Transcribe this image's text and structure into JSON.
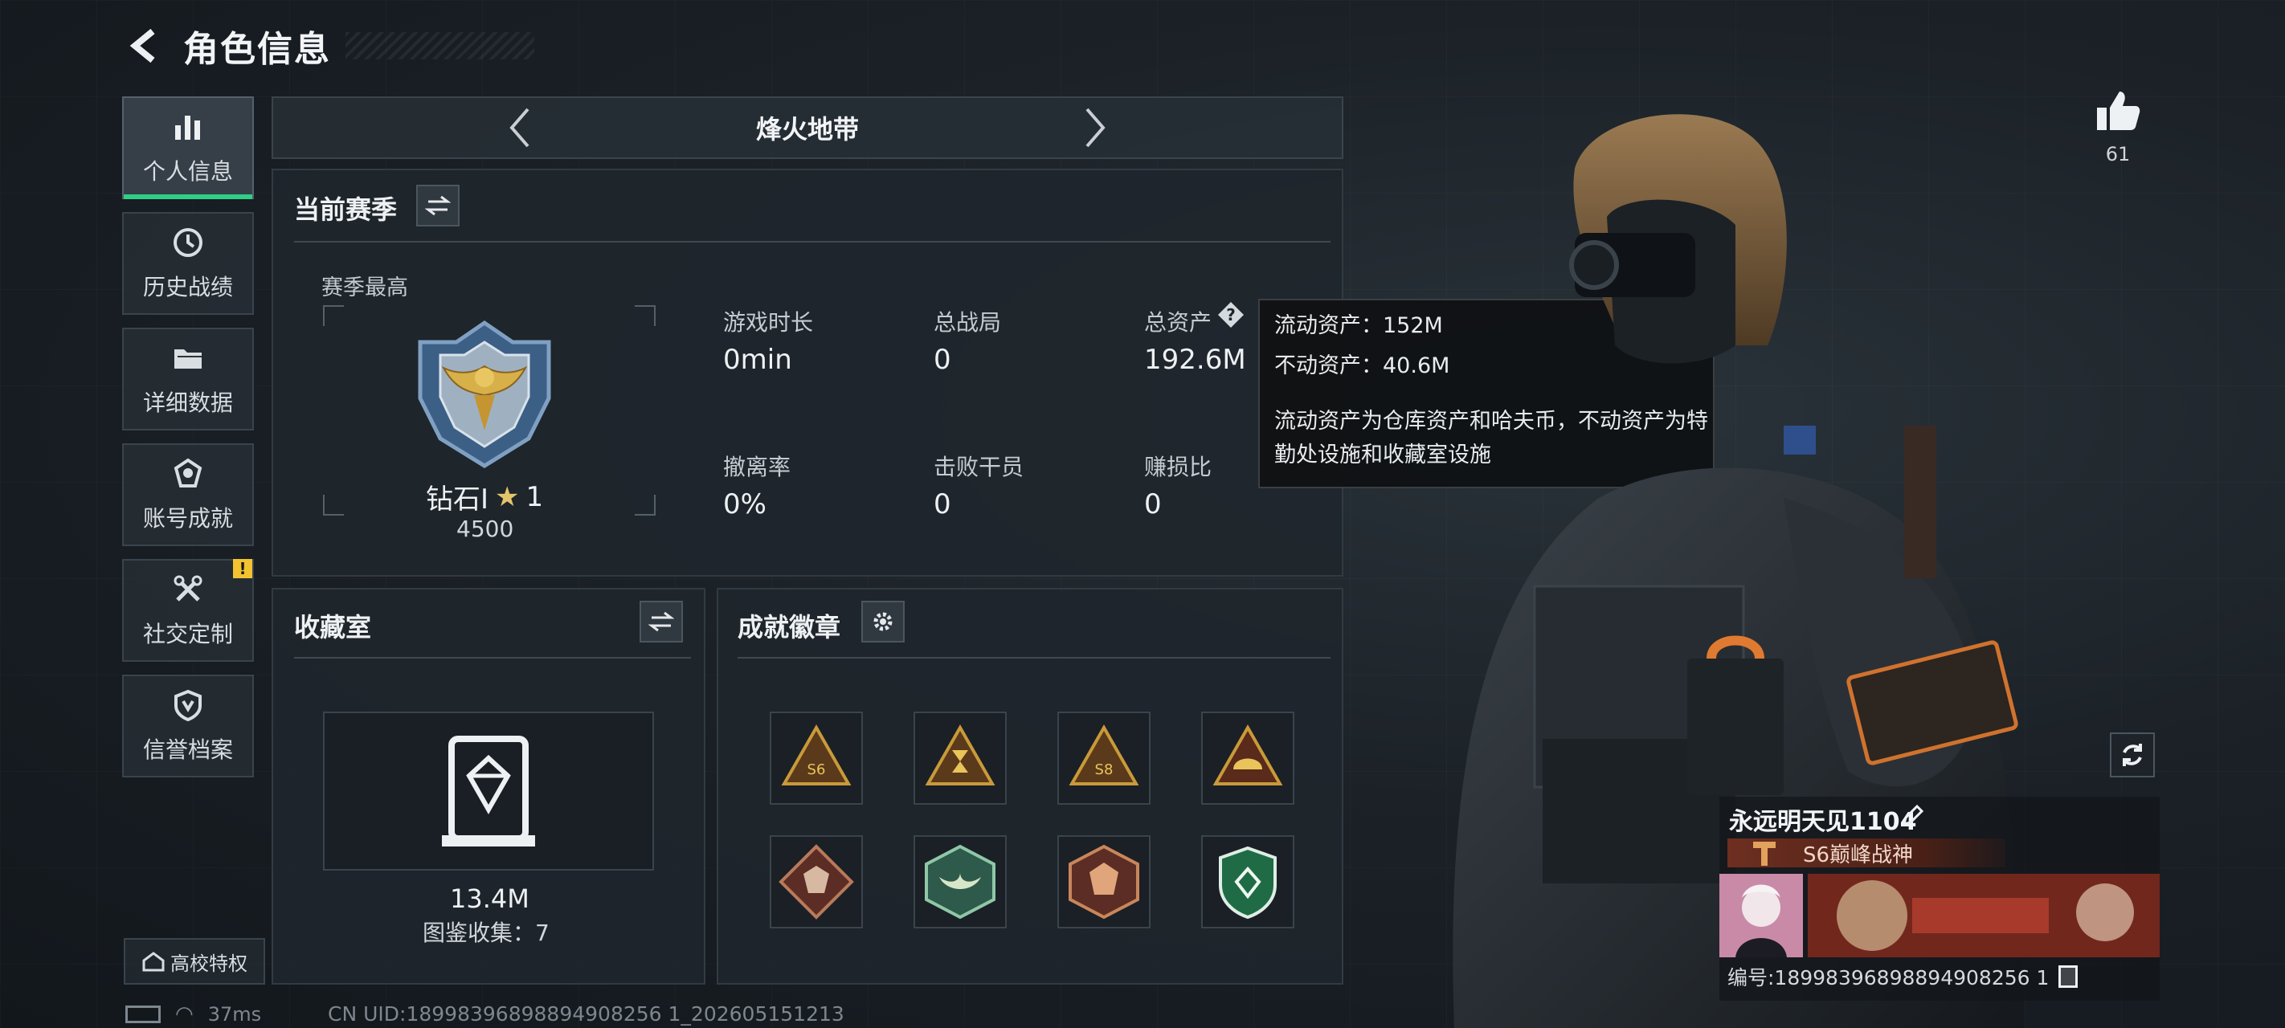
{
  "header": {
    "title": "角色信息"
  },
  "sidebar": {
    "items": [
      {
        "label": "个人信息",
        "icon": "bar-chart-icon",
        "active": true
      },
      {
        "label": "历史战绩",
        "icon": "history-clock-icon"
      },
      {
        "label": "详细数据",
        "icon": "folder-icon"
      },
      {
        "label": "账号成就",
        "icon": "achievement-icon"
      },
      {
        "label": "社交定制",
        "icon": "tools-icon",
        "badge": "!"
      },
      {
        "label": "信誉档案",
        "icon": "shield-icon"
      }
    ],
    "campus": "高校特权"
  },
  "mode": {
    "title": "烽火地带"
  },
  "season": {
    "title": "当前赛季",
    "best_label": "赛季最高",
    "rank_name": "钻石Ⅰ",
    "rank_stars": "1",
    "rank_score": "4500",
    "stats": [
      {
        "label": "游戏时长",
        "value": "0min"
      },
      {
        "label": "总战局",
        "value": "0"
      },
      {
        "label": "总资产",
        "value": "192.6M"
      },
      {
        "label": "撤离率",
        "value": "0%"
      },
      {
        "label": "击败干员",
        "value": "0"
      },
      {
        "label": "赚损比",
        "value": "0"
      }
    ]
  },
  "tooltip": {
    "line1": "流动资产：152M",
    "line2": "不动资产：40.6M",
    "desc": "流动资产为仓库资产和哈夫币，不动资产为特勤处设施和收藏室设施"
  },
  "collection": {
    "title": "收藏室",
    "value": "13.4M",
    "count_text": "图鉴收集：7"
  },
  "badges": {
    "title": "成就徽章",
    "items": [
      "badge-s6-gold",
      "badge-hourglass",
      "badge-s8",
      "badge-helmet",
      "badge-wolf",
      "badge-eagle-green",
      "badge-dragon",
      "badge-shield-green"
    ]
  },
  "player": {
    "likes": "61",
    "name": "永远明天见1104",
    "rank_title": "S6巅峰战神",
    "id_text": "编号:18998396898894908256 1"
  },
  "status": {
    "ping": "37ms",
    "uid": "CN UID:18998396898894908256 1_202605151213"
  }
}
